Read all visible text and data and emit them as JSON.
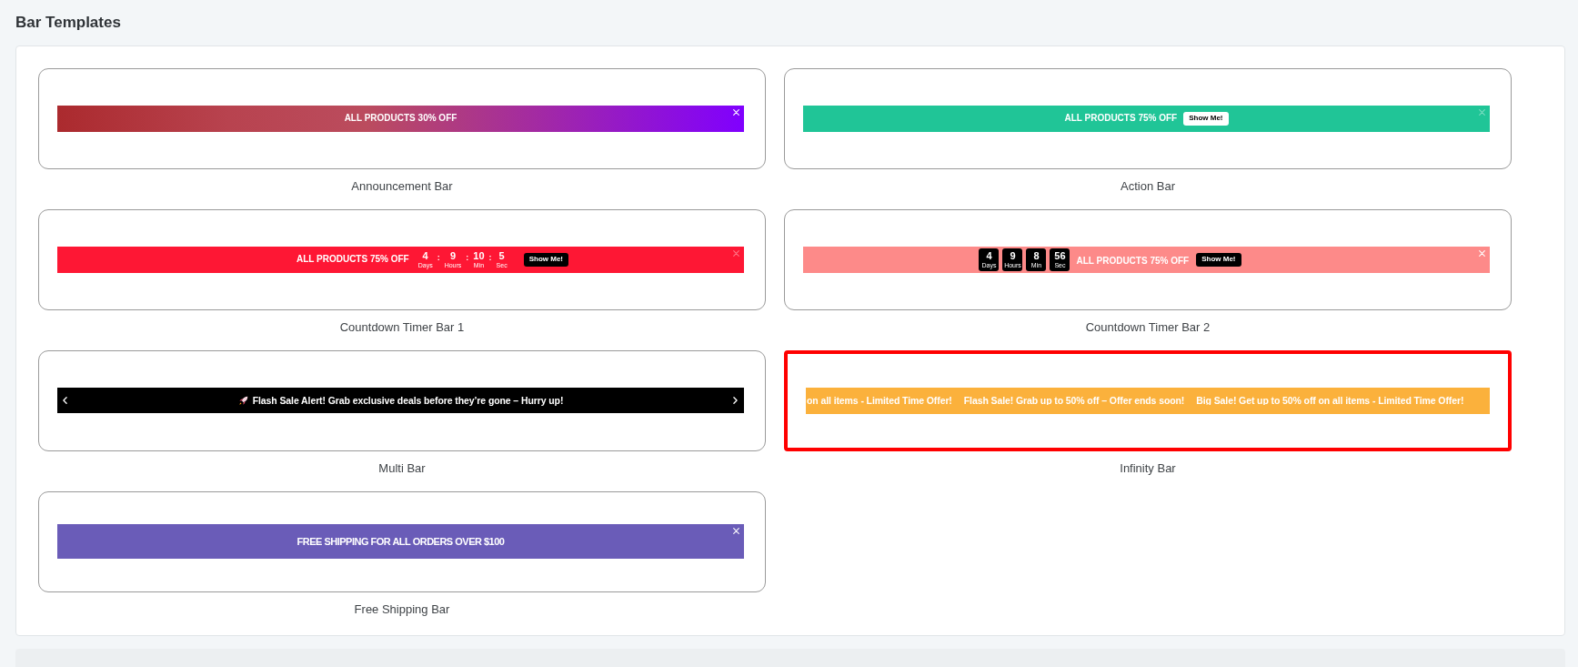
{
  "title": "Bar Templates",
  "templates": [
    {
      "name": "Announcement Bar",
      "selected": false,
      "bar": {
        "kind": "announcement",
        "closable": true,
        "text": "ALL PRODUCTS 30% OFF"
      }
    },
    {
      "name": "Action Bar",
      "selected": false,
      "bar": {
        "kind": "action",
        "closable": true,
        "text": "ALL PRODUCTS 75% OFF",
        "button": "Show Me!"
      }
    },
    {
      "name": "Countdown Timer Bar 1",
      "selected": false,
      "bar": {
        "kind": "countdown_inline",
        "closable": true,
        "text": "ALL PRODUCTS 75% OFF",
        "timer": [
          {
            "value": "4",
            "unit": "Days"
          },
          {
            "separator": ":",
            "value": "9",
            "unit": "Hours"
          },
          {
            "separator": ":",
            "value": "10",
            "unit": "Min"
          },
          {
            "separator": ":",
            "value": "5",
            "unit": "Sec"
          }
        ],
        "button": "Show Me!"
      }
    },
    {
      "name": "Countdown Timer Bar 2",
      "selected": false,
      "bar": {
        "kind": "countdown_boxed",
        "closable": true,
        "timer": [
          {
            "value": "4",
            "unit": "Days"
          },
          {
            "value": "9",
            "unit": "Hours"
          },
          {
            "value": "8",
            "unit": "Min"
          },
          {
            "value": "56",
            "unit": "Sec"
          }
        ],
        "text": "ALL PRODUCTS 75% OFF",
        "button": "Show Me!"
      }
    },
    {
      "name": "Multi Bar",
      "selected": false,
      "bar": {
        "kind": "slider",
        "closable": false,
        "text": "Flash Sale Alert! Grab exclusive deals before they’re gone – Hurry up!"
      }
    },
    {
      "name": "Infinity Bar",
      "selected": true,
      "bar": {
        "kind": "marquee",
        "closable": false,
        "items": [
          "on all items - Limited Time Offer!",
          "Flash Sale! Grab up to 50% off – Offer ends soon!",
          "Big Sale! Get up to 50% off on all items - Limited Time Offer!"
        ]
      }
    },
    {
      "name": "Free Shipping Bar",
      "selected": false,
      "bar": {
        "kind": "shipping",
        "closable": true,
        "text": "FREE SHIPPING FOR ALL ORDERS OVER $100"
      }
    }
  ]
}
